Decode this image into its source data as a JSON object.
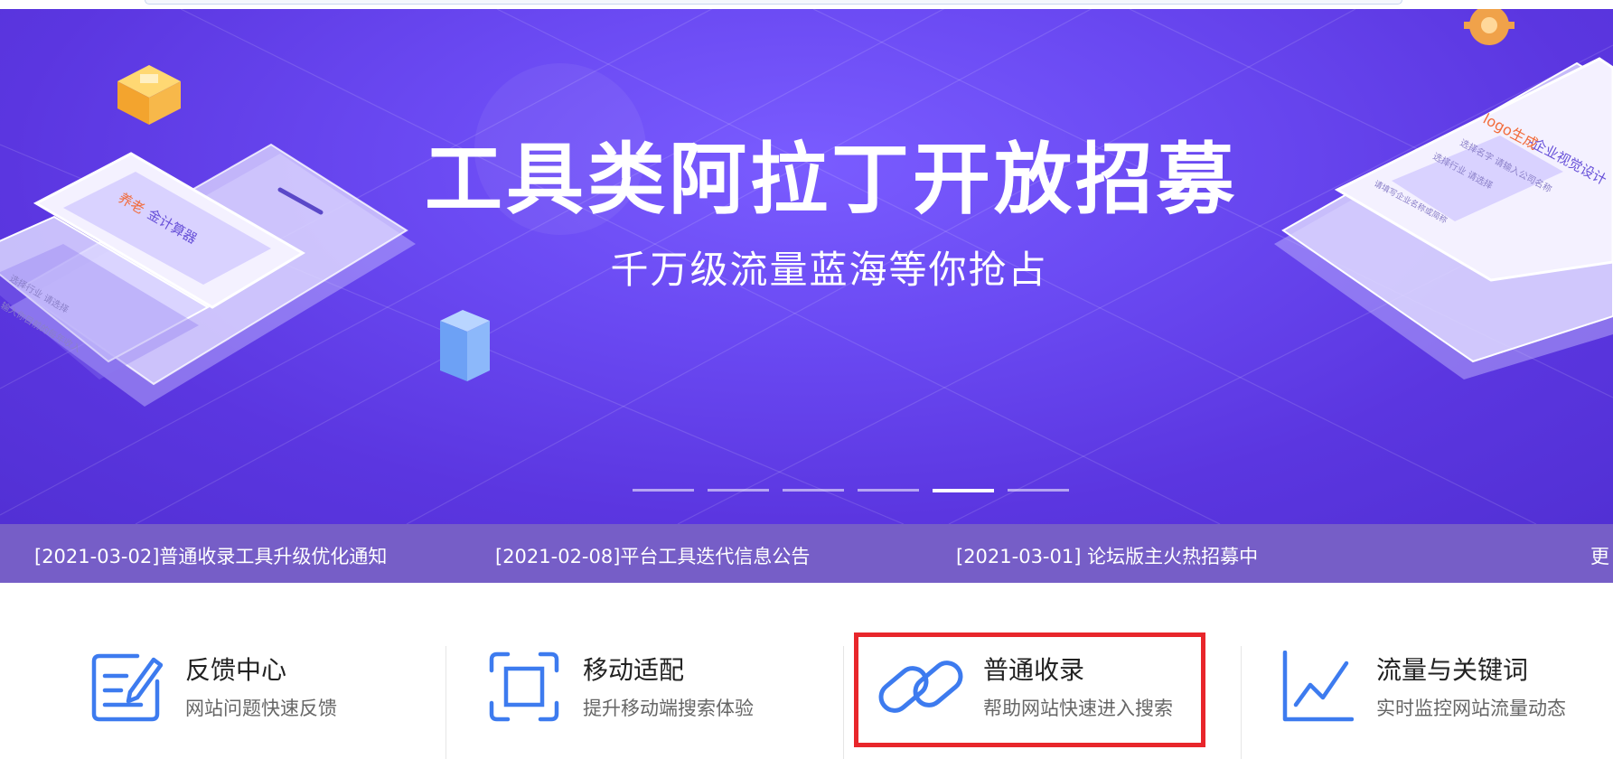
{
  "banner": {
    "headline": "工具类阿拉丁开放招募",
    "subline": "千万级流量蓝海等你抢占",
    "slides_count": 6,
    "active_slide": 5,
    "left_card": {
      "title_accent": "养老",
      "title_rest": "金计算器",
      "row1": "选择行业  请选择",
      "row2": "输入你目前的每年收入"
    },
    "right_card": {
      "title_accent": "logo生成",
      "title_rest": "-企业视觉设计",
      "row1": "选择名字  请输入公司名称",
      "row2": "选择行业  请选择",
      "row3": "请填写企业名称或简称"
    }
  },
  "news": [
    "[2021-03-02]普通收录工具升级优化通知",
    "[2021-02-08]平台工具迭代信息公告",
    "[2021-03-01] 论坛版主火热招募中"
  ],
  "more_label": "更",
  "features": [
    {
      "title": "反馈中心",
      "desc": "网站问题快速反馈",
      "icon": "feedback-edit-icon"
    },
    {
      "title": "移动适配",
      "desc": "提升移动端搜索体验",
      "icon": "mobile-adapt-icon"
    },
    {
      "title": "普通收录",
      "desc": "帮助网站快速进入搜索",
      "icon": "link-chain-icon",
      "highlighted": true
    },
    {
      "title": "流量与关键词",
      "desc": "实时监控网站流量动态",
      "icon": "traffic-chart-icon"
    }
  ],
  "colors": {
    "banner": "#6a49f2",
    "icon_blue": "#3d7bef",
    "highlight": "#e8262b"
  }
}
